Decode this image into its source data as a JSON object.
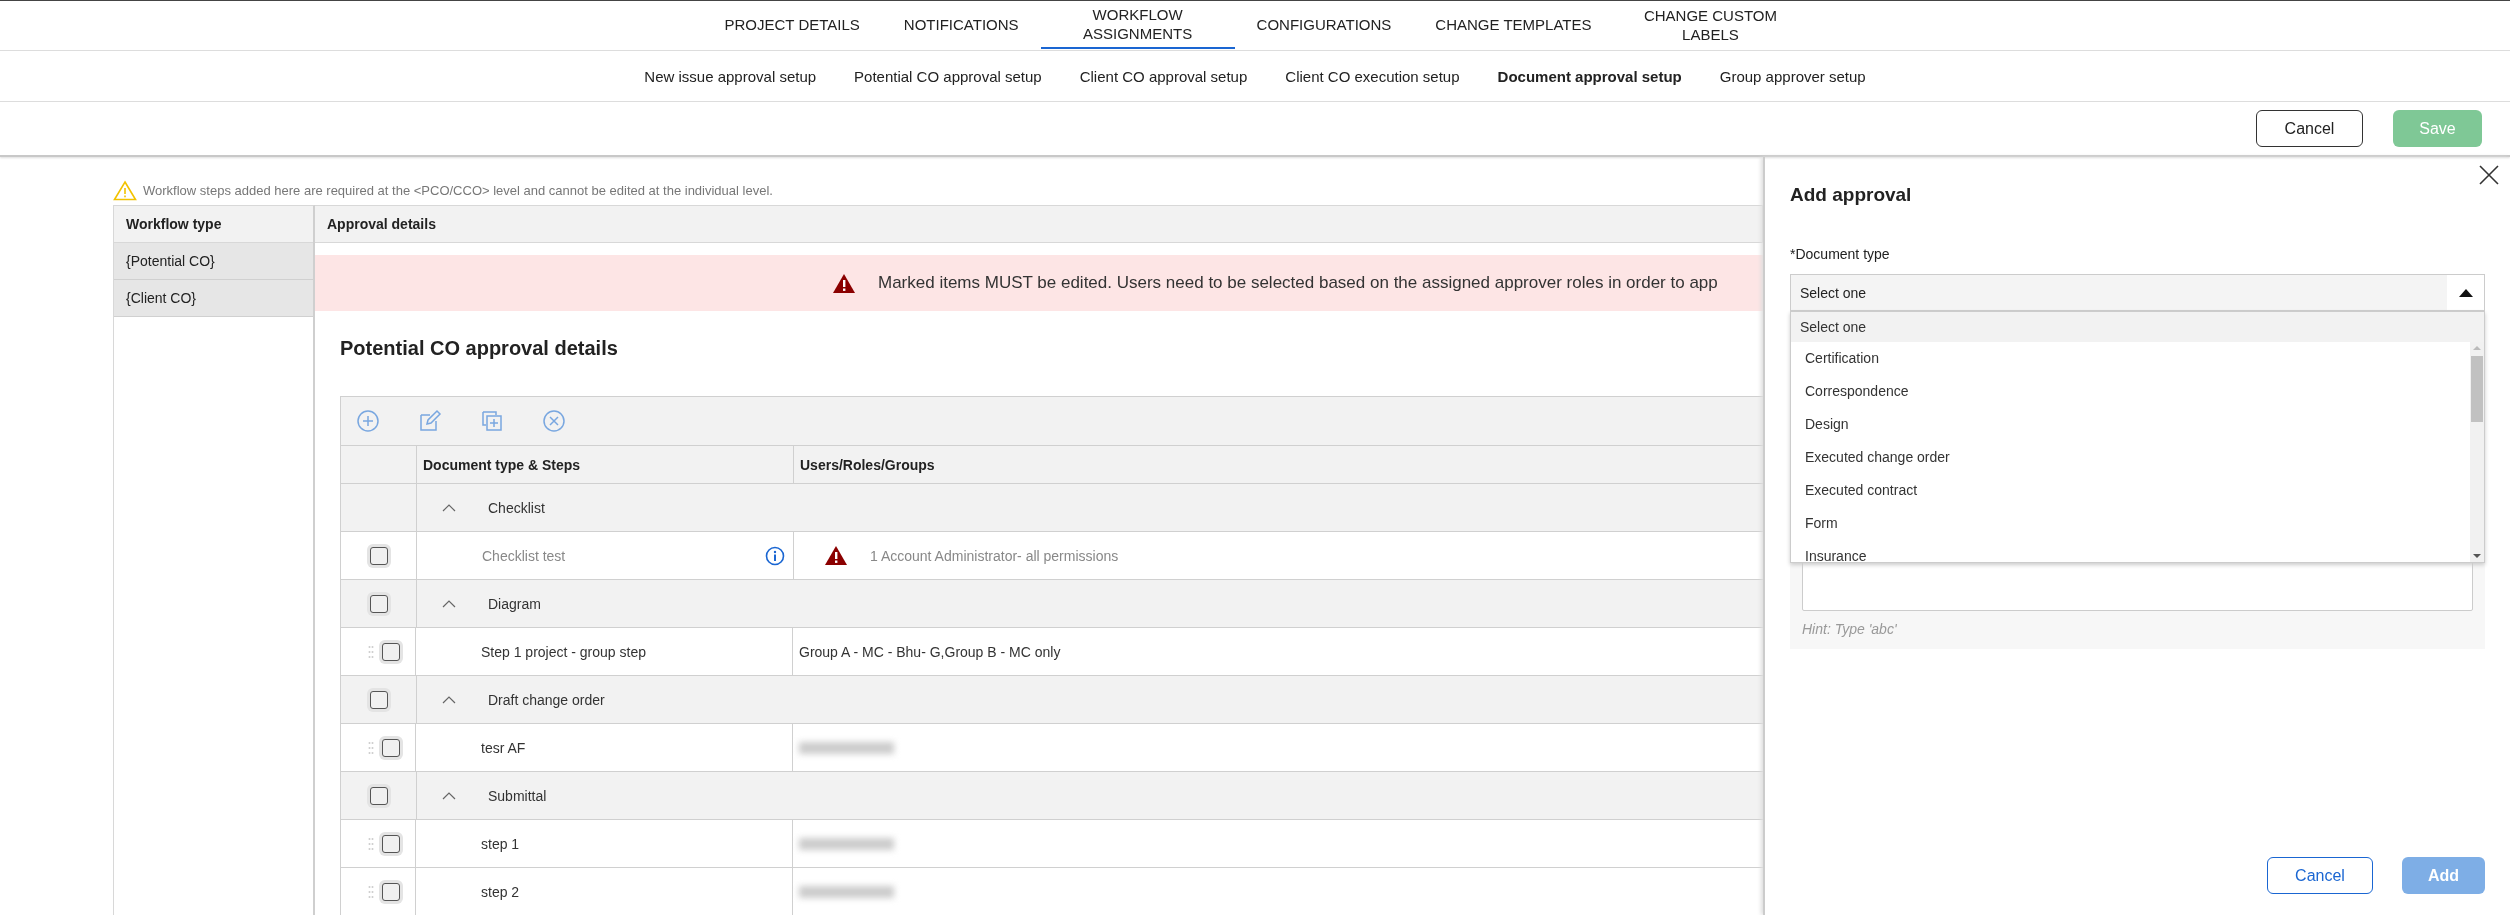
{
  "top_tabs": [
    {
      "label": "PROJECT DETAILS",
      "selected": false
    },
    {
      "label": "NOTIFICATIONS",
      "selected": false
    },
    {
      "label": "WORKFLOW ASSIGNMENTS",
      "selected": true
    },
    {
      "label": "CONFIGURATIONS",
      "selected": false
    },
    {
      "label": "CHANGE TEMPLATES",
      "selected": false
    },
    {
      "label": "CHANGE CUSTOM LABELS",
      "selected": false
    }
  ],
  "sub_tabs": [
    {
      "label": "New issue approval setup",
      "selected": false
    },
    {
      "label": "Potential CO approval setup",
      "selected": false
    },
    {
      "label": "Client CO approval setup",
      "selected": false
    },
    {
      "label": "Client CO execution setup",
      "selected": false
    },
    {
      "label": "Document approval setup",
      "selected": true
    },
    {
      "label": "Group approver setup",
      "selected": false
    }
  ],
  "actions": [
    {
      "label": "Cancel",
      "kind": "outline",
      "disabled": false
    },
    {
      "label": "Save",
      "kind": "primary",
      "disabled": true
    }
  ],
  "notice": "Workflow steps added here are required at the <PCO/CCO> level and cannot be edited at the individual level.",
  "workflow_types": {
    "header": "Workflow type",
    "items": [
      {
        "label": "{Potential CO}"
      },
      {
        "label": "{Client CO}"
      }
    ]
  },
  "approval_details": {
    "header": "Approval details",
    "alert": "Marked items MUST be edited. Users need to be selected based on the assigned approver roles in order to app",
    "title": "Potential CO approval details",
    "table": {
      "columns": [
        "Document type & Steps",
        "Users/Roles/Groups"
      ],
      "rows": [
        {
          "kind": "group",
          "label": "Checklist",
          "expanded": true
        },
        {
          "kind": "step",
          "label": "Checklist test",
          "checked": false,
          "draggable": false,
          "flagged": true,
          "users": "1 Account Administrator- all permissions"
        },
        {
          "kind": "group",
          "label": "Diagram",
          "checked": false,
          "expanded": true
        },
        {
          "kind": "step",
          "label": "Step 1 project - group step",
          "checked": false,
          "draggable": true,
          "flagged": false,
          "users": "Group A - MC - Bhu- G,Group B - MC only"
        },
        {
          "kind": "group",
          "label": "Draft change order",
          "checked": false,
          "expanded": true
        },
        {
          "kind": "step",
          "label": "tesr AF",
          "checked": false,
          "draggable": true,
          "flagged": false,
          "users_hidden": true
        },
        {
          "kind": "group",
          "label": "Submittal",
          "checked": false,
          "expanded": true
        },
        {
          "kind": "step",
          "label": "step 1",
          "checked": false,
          "draggable": true,
          "flagged": false,
          "users_hidden": true
        },
        {
          "kind": "step",
          "label": "step 2",
          "checked": false,
          "draggable": true,
          "flagged": false,
          "users_hidden": true
        }
      ]
    }
  },
  "panel": {
    "title": "Add approval",
    "field_label": "*Document type",
    "select_value": "Select one",
    "expanded": true,
    "options": [
      {
        "label": "Select one",
        "selected": true
      },
      {
        "label": "Certification",
        "selected": false
      },
      {
        "label": "Correspondence",
        "selected": false
      },
      {
        "label": "Design",
        "selected": false
      },
      {
        "label": "Executed change order",
        "selected": false
      },
      {
        "label": "Executed contract",
        "selected": false
      },
      {
        "label": "Form",
        "selected": false
      },
      {
        "label": "Insurance",
        "selected": false
      }
    ],
    "hint": "Hint: Type 'abc'",
    "buttons": [
      {
        "label": "Cancel",
        "kind": "outline",
        "disabled": false
      },
      {
        "label": "Add",
        "kind": "primary",
        "disabled": true
      }
    ]
  }
}
